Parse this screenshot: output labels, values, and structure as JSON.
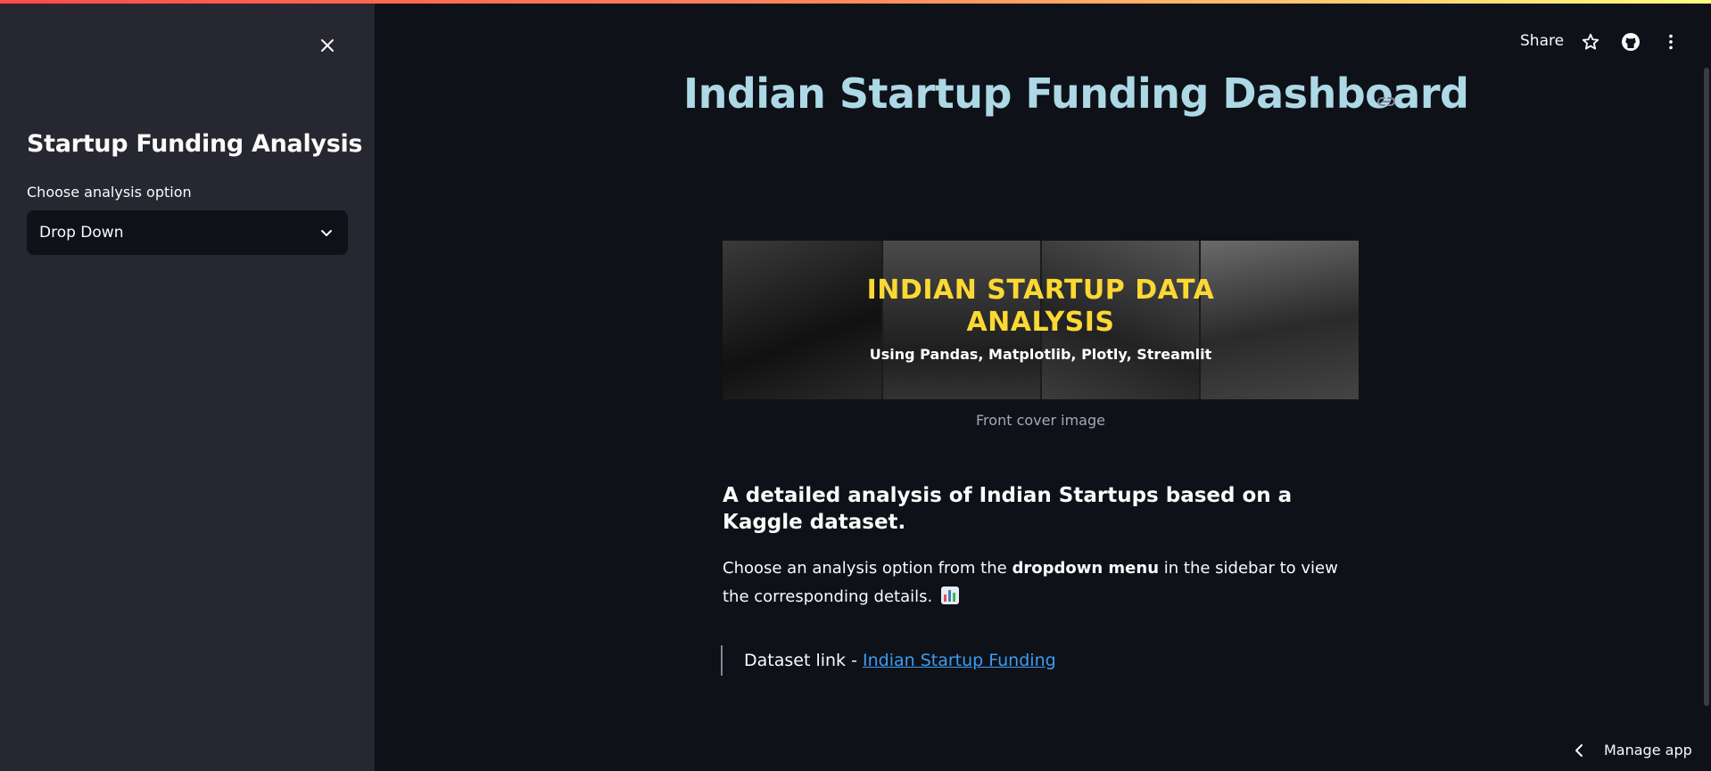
{
  "header": {
    "share_label": "Share",
    "icons": [
      "star-icon",
      "github-icon",
      "more-vertical-icon"
    ]
  },
  "sidebar": {
    "title": "Startup Funding Analysis",
    "select_label": "Choose analysis option",
    "select_value": "Drop Down"
  },
  "main": {
    "title": "Indian Startup Funding Dashboard",
    "cover": {
      "title_line1": "INDIAN STARTUP DATA",
      "title_line2": "ANALYSIS",
      "subtitle": "Using Pandas, Matplotlib, Plotly, Streamlit",
      "caption": "Front cover image"
    },
    "subheading": "A detailed analysis of Indian Startups based on a Kaggle dataset.",
    "body_prefix": "Choose an analysis option from the ",
    "body_bold": "dropdown menu",
    "body_suffix": " in the sidebar to view the corresponding details.",
    "dataset_prefix": "Dataset link - ",
    "dataset_link": "Indian Startup Funding"
  },
  "footer": {
    "manage_app": "Manage app"
  },
  "colors": {
    "background": "#0e1117",
    "sidebar": "#262730",
    "title": "#add8e6",
    "link": "#3d9df3",
    "cover_title": "#fcd834"
  }
}
